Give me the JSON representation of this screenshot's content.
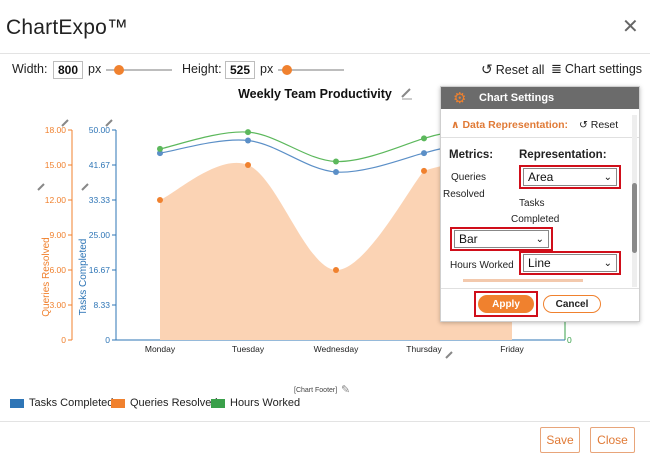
{
  "app": {
    "title": "ChartExpo™"
  },
  "toolbar": {
    "width_label": "Width:",
    "width_value": "800",
    "width_unit": "px",
    "height_label": "Height:",
    "height_value": "525",
    "height_unit": "px",
    "reset_all": "Reset all",
    "chart_settings": "Chart settings"
  },
  "chart_data": {
    "type": "area",
    "title": "Weekly Team Productivity",
    "categories": [
      "Monday",
      "Tuesday",
      "Wednesday",
      "Thursday",
      "Friday"
    ],
    "y_axes": [
      {
        "label": "Queries Resolved",
        "ticks": [
          "18.00",
          "15.00",
          "12.00",
          "9.00",
          "6.00",
          "3.00",
          "0"
        ],
        "range": [
          0,
          18
        ],
        "color": "#f0812e"
      },
      {
        "label": "Tasks Completed",
        "ticks": [
          "50.00",
          "41.67",
          "33.33",
          "25.00",
          "16.67",
          "8.33",
          "0"
        ],
        "range": [
          0,
          50
        ],
        "color": "#2e75b6"
      },
      {
        "label": "",
        "ticks": [
          "0"
        ],
        "range": [
          0,
          50
        ],
        "color": "#3aa04a"
      }
    ],
    "series": [
      {
        "name": "Queries Resolved",
        "type": "area",
        "axis": 0,
        "color": "#f0812e",
        "fill": "#fbd3b4",
        "values": [
          12,
          15,
          6,
          14.5,
          null
        ]
      },
      {
        "name": "Tasks Completed",
        "type": "line",
        "axis": 1,
        "color": "#5b8fc7",
        "values": [
          44.5,
          47.5,
          40,
          44.5,
          null
        ]
      },
      {
        "name": "Hours Worked",
        "type": "line",
        "axis": 1,
        "color": "#5cb85c",
        "values": [
          45.5,
          49.5,
          42.5,
          48,
          null
        ]
      }
    ],
    "legend": [
      "Tasks Completed",
      "Queries Resolved",
      "Hours Worked"
    ],
    "legend_colors": [
      "#2e75b6",
      "#f0812e",
      "#3aa04a"
    ],
    "legend_position": "bottom-left",
    "footer": "[Chart Footer]"
  },
  "settings": {
    "title": "Chart Settings",
    "section": "Data Representation:",
    "reset": "Reset",
    "metrics_header": "Metrics:",
    "representation_header": "Representation:",
    "rows": [
      {
        "metric_line1": "Queries",
        "metric_line2": "Resolved",
        "representation": "Area"
      },
      {
        "metric_line1": "Tasks",
        "metric_line2": "Completed",
        "representation": "Bar"
      },
      {
        "metric_line1": "Hours Worked",
        "metric_line2": "",
        "representation": "Line"
      }
    ],
    "apply": "Apply",
    "cancel": "Cancel"
  },
  "footer": {
    "save": "Save",
    "close": "Close"
  }
}
